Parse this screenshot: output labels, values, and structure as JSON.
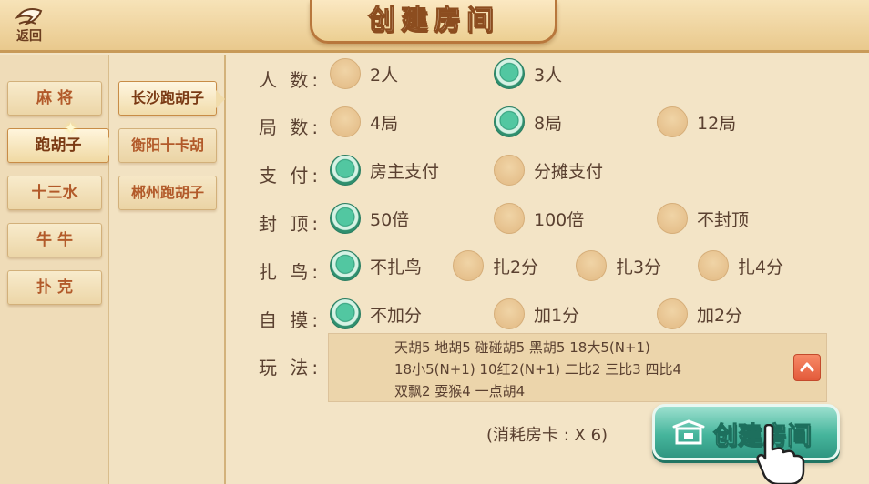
{
  "header": {
    "back_label": "返回",
    "title": "创建房间"
  },
  "categories": [
    {
      "label": "麻 将",
      "active": false
    },
    {
      "label": "跑胡子",
      "active": true
    },
    {
      "label": "十三水",
      "active": false
    },
    {
      "label": "牛 牛",
      "active": false
    },
    {
      "label": "扑 克",
      "active": false
    }
  ],
  "sub_games": [
    {
      "label": "长沙跑胡子",
      "active": true
    },
    {
      "label": "衡阳十卡胡",
      "active": false
    },
    {
      "label": "郴州跑胡子",
      "active": false
    }
  ],
  "settings": {
    "players": {
      "label": "人 数:",
      "options": [
        {
          "label": "2人",
          "selected": false
        },
        {
          "label": "3人",
          "selected": true
        }
      ]
    },
    "rounds": {
      "label": "局 数:",
      "options": [
        {
          "label": "4局",
          "selected": false
        },
        {
          "label": "8局",
          "selected": true
        },
        {
          "label": "12局",
          "selected": false
        }
      ]
    },
    "payment": {
      "label": "支 付:",
      "options": [
        {
          "label": "房主支付",
          "selected": true
        },
        {
          "label": "分摊支付",
          "selected": false
        }
      ]
    },
    "cap": {
      "label": "封 顶:",
      "options": [
        {
          "label": "50倍",
          "selected": true
        },
        {
          "label": "100倍",
          "selected": false
        },
        {
          "label": "不封顶",
          "selected": false
        }
      ]
    },
    "bird": {
      "label": "扎 鸟:",
      "options": [
        {
          "label": "不扎鸟",
          "selected": true
        },
        {
          "label": "扎2分",
          "selected": false
        },
        {
          "label": "扎3分",
          "selected": false
        },
        {
          "label": "扎4分",
          "selected": false
        }
      ]
    },
    "self_draw": {
      "label": "自 摸:",
      "options": [
        {
          "label": "不加分",
          "selected": true
        },
        {
          "label": "加1分",
          "selected": false
        },
        {
          "label": "加2分",
          "selected": false
        }
      ]
    },
    "rules": {
      "label": "玩 法:",
      "lines": [
        "天胡5   地胡5   碰碰胡5   黑胡5   18大5(N+1)",
        "18小5(N+1)   10红2(N+1)   二比2   三比3   四比4",
        "双飘2   耍猴4   一点胡4"
      ]
    }
  },
  "cost_text": "(消耗房卡 : X 6)",
  "create_button_label": "创建房间",
  "icons": {
    "back": "back-arrow-icon",
    "scroll_up": "chevron-up-icon",
    "create": "house-icon",
    "hand": "pointing-hand-icon"
  },
  "colors": {
    "selected_radio": "#2e9c78",
    "create_button": "#46b59c",
    "active_text": "#7a3a14"
  }
}
